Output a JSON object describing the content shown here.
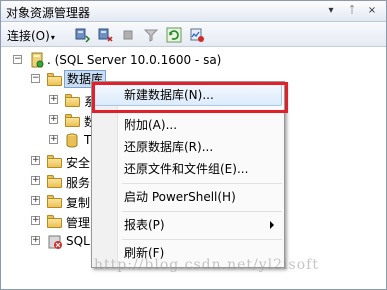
{
  "window": {
    "title": "对象资源管理器"
  },
  "title_controls": {
    "dropdown": "▾",
    "pin": "ᛏ",
    "close": "×"
  },
  "toolbar": {
    "connect_label": "连接(O)",
    "connect_arrow": "▾"
  },
  "tree": {
    "server_label": ". (SQL Server 10.0.1600 - sa)",
    "databases_label": "数据库",
    "partial_labels": [
      "安全",
      "服务",
      "复制",
      "管理",
      "SQL"
    ],
    "child_partial": [
      "系",
      "数",
      "T"
    ]
  },
  "context_menu": {
    "items": [
      {
        "label": "新建数据库(N)..."
      },
      {
        "label": "附加(A)..."
      },
      {
        "label": "还原数据库(R)..."
      },
      {
        "label": "还原文件和文件组(E)..."
      },
      {
        "label": "启动 PowerShell(H)"
      },
      {
        "label": "报表(P)"
      },
      {
        "label": "刷新(F)"
      }
    ]
  },
  "watermark": "http://blog.csdn.net/yl2isoft",
  "colors": {
    "highlight_box": "#e0212b",
    "selection": "#c8ddf4"
  }
}
